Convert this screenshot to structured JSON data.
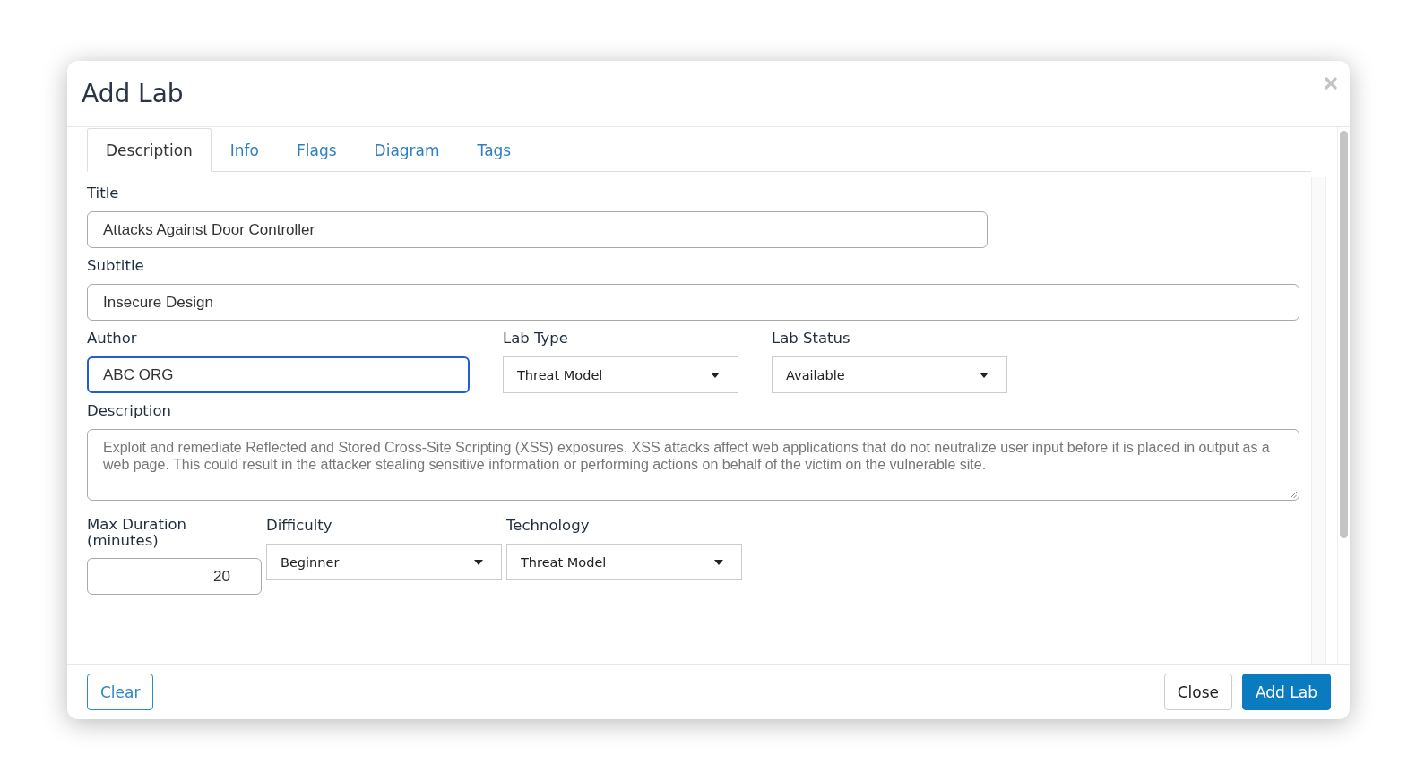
{
  "dialog": {
    "title": "Add Lab"
  },
  "tabs": [
    {
      "label": "Description",
      "selected": true
    },
    {
      "label": "Info",
      "selected": false
    },
    {
      "label": "Flags",
      "selected": false
    },
    {
      "label": "Diagram",
      "selected": false
    },
    {
      "label": "Tags",
      "selected": false
    }
  ],
  "rows": [
    [
      {
        "kind": "text",
        "label": "Title",
        "value": "Attacks Against Door Controller",
        "focused": false
      }
    ],
    [
      {
        "kind": "text",
        "label": "Subtitle",
        "value": "Insecure Design",
        "focused": false
      }
    ],
    [
      {
        "kind": "text",
        "label": "Author",
        "value": "ABC ORG",
        "focused": true
      },
      {
        "kind": "select",
        "label": "Lab Type",
        "value": "Threat Model",
        "focused": false
      },
      {
        "kind": "select",
        "label": "Lab Status",
        "value": "Available",
        "focused": false
      }
    ],
    [
      {
        "kind": "textarea",
        "label": "Description",
        "value": "Exploit and remediate Reflected and Stored Cross-Site Scripting (XSS) exposures. XSS attacks affect web applications that do not neutralize user input before it is placed in output as a web page. This could result in the attacker stealing sensitive information or performing actions on behalf of the victim on the vulnerable site.",
        "focused": false
      }
    ],
    [
      {
        "kind": "number",
        "label": "Max Duration (minutes)",
        "value": "20",
        "focused": false
      },
      {
        "kind": "select",
        "label": "Difficulty",
        "value": "Beginner",
        "focused": false
      },
      {
        "kind": "select",
        "label": "Technology",
        "value": "Threat Model",
        "focused": false
      }
    ]
  ],
  "footer": {
    "left_button": "Clear",
    "right_buttons": [
      {
        "label": "Close",
        "primary": false
      },
      {
        "label": "Add Lab",
        "primary": true
      }
    ]
  }
}
